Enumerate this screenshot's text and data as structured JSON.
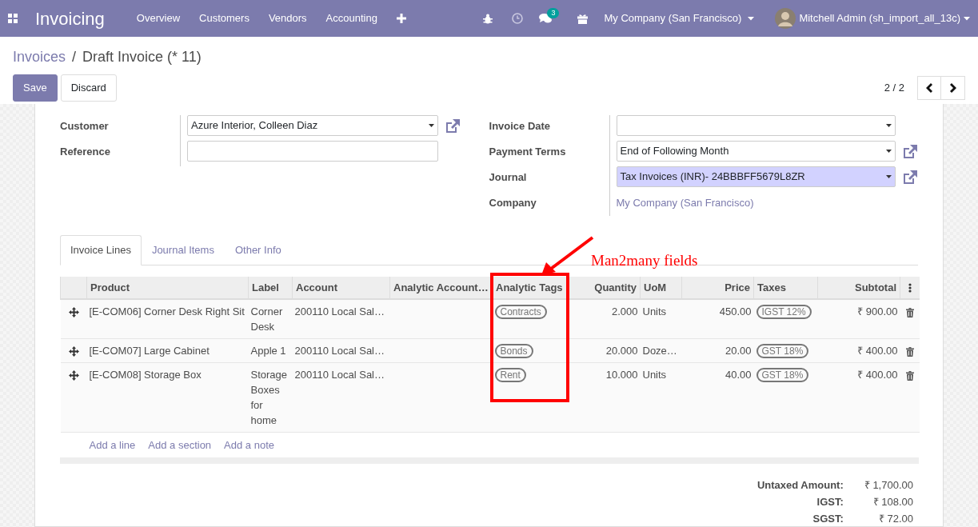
{
  "navbar": {
    "app_title": "Invoicing",
    "menu": [
      {
        "label": "Overview"
      },
      {
        "label": "Customers"
      },
      {
        "label": "Vendors"
      },
      {
        "label": "Accounting"
      }
    ],
    "message_count": "3",
    "company": "My Company (San Francisco)",
    "user": "Mitchell Admin (sh_import_all_13c)"
  },
  "breadcrumb_separator": "/",
  "breadcrumb": [
    {
      "label": "Invoices",
      "link": true
    },
    {
      "label": "Draft Invoice (* 11)",
      "link": false
    }
  ],
  "buttons": [
    {
      "label": "Save",
      "primary": true
    },
    {
      "label": "Discard",
      "primary": false
    }
  ],
  "pager": "2 / 2",
  "form_left": [
    {
      "label": "Customer",
      "kind": "select",
      "value": "Azure Interior, Colleen Diaz",
      "highlighted": false,
      "open_link": true
    },
    {
      "label": "Reference",
      "kind": "input",
      "highlighted": false,
      "open_link": false
    }
  ],
  "form_right": [
    {
      "label": "Invoice Date",
      "kind": "select",
      "highlighted": false,
      "open_link": false
    },
    {
      "label": "Payment Terms",
      "kind": "select",
      "value": "End of Following Month",
      "highlighted": false,
      "open_link": true
    },
    {
      "label": "Journal",
      "kind": "select",
      "value": "Tax Invoices (INR)- 24BBBFF5679L8ZR",
      "highlighted": true,
      "open_link": true
    },
    {
      "label": "Company",
      "kind": "link",
      "value": "My Company (San Francisco)",
      "open_link": false
    }
  ],
  "tabs": [
    {
      "label": "Invoice Lines",
      "selected": true
    },
    {
      "label": "Journal Items",
      "selected": false
    },
    {
      "label": "Other Info",
      "selected": false
    }
  ],
  "table": {
    "columns": [
      {
        "label": "Product"
      },
      {
        "label": "Label"
      },
      {
        "label": "Account"
      },
      {
        "label": "Analytic Account…"
      },
      {
        "label": "Analytic Tags"
      },
      {
        "label": "Quantity"
      },
      {
        "label": "UoM"
      },
      {
        "label": "Price"
      },
      {
        "label": "Taxes"
      },
      {
        "label": "Subtotal"
      }
    ],
    "rows": [
      {
        "product": "[E-COM06] Corner Desk Right Sit",
        "label": "Corner Desk",
        "account": "200110 Local Sal…",
        "tags": [
          "Contracts"
        ],
        "quantity": "2.000",
        "uom": "Units",
        "price": "450.00",
        "taxes": [
          "IGST 12%"
        ],
        "subtotal": "₹ 900.00"
      },
      {
        "product": "[E-COM07] Large Cabinet",
        "label": "Apple 1",
        "account": "200110 Local Sal…",
        "tags": [
          "Bonds"
        ],
        "quantity": "20.000",
        "uom": "Doze…",
        "price": "20.00",
        "taxes": [
          "GST 18%"
        ],
        "subtotal": "₹ 400.00"
      },
      {
        "product": "[E-COM08] Storage Box",
        "label": "Storage Boxes for home",
        "account": "200110 Local Sal…",
        "tags": [
          "Rent"
        ],
        "quantity": "10.000",
        "uom": "Units",
        "price": "40.00",
        "taxes": [
          "GST 18%"
        ],
        "subtotal": "₹ 400.00"
      }
    ],
    "add_links": [
      "Add a line",
      "Add a section",
      "Add a note"
    ]
  },
  "totals": [
    {
      "label": "Untaxed Amount:",
      "value": "₹ 1,700.00"
    },
    {
      "label": "IGST:",
      "value": "₹ 108.00"
    },
    {
      "label": "SGST:",
      "value": "₹ 72.00"
    }
  ],
  "annotation": {
    "text": "Man2many fields"
  }
}
